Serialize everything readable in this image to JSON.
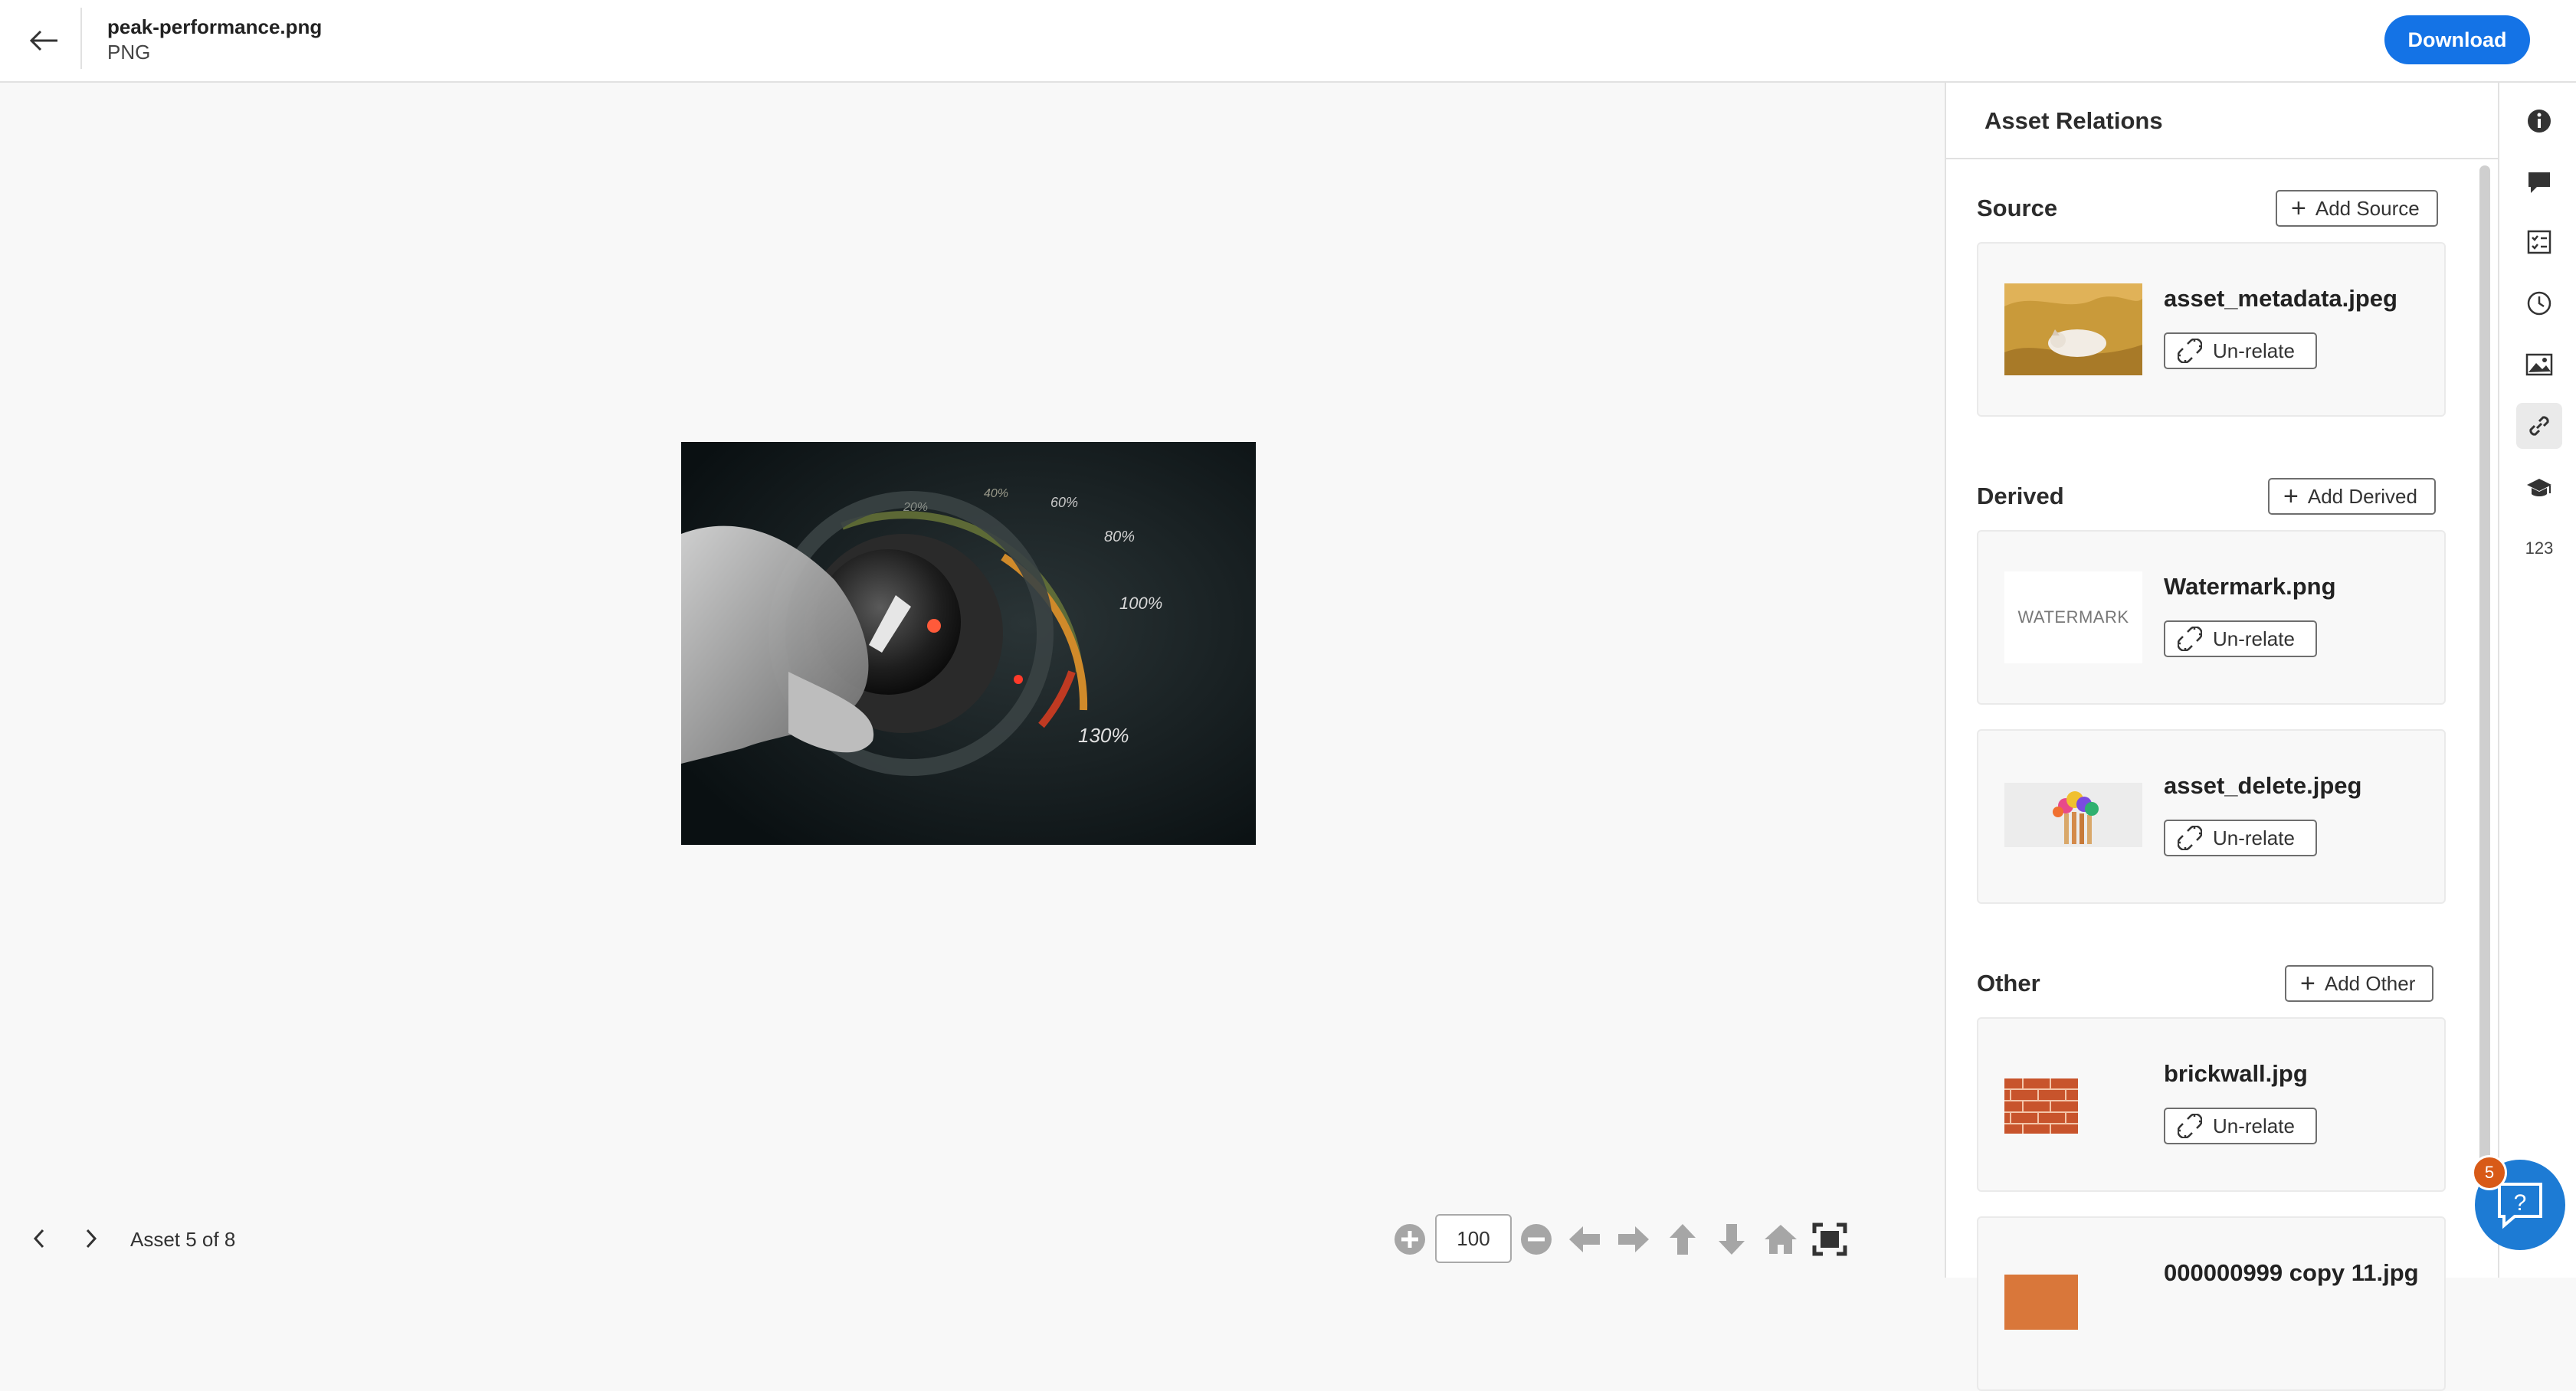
{
  "header": {
    "file_name": "peak-performance.png",
    "file_type": "PNG",
    "download_label": "Download"
  },
  "preview": {
    "gauge_labels": [
      "20%",
      "40%",
      "60%",
      "80%",
      "100%",
      "130%"
    ]
  },
  "footer": {
    "asset_count": "Asset 5 of 8",
    "zoom_value": "100"
  },
  "panel": {
    "title": "Asset Relations",
    "unrelate_label": "Un-relate",
    "sections": {
      "source": {
        "title": "Source",
        "add_label": "Add Source",
        "items": [
          {
            "name": "asset_metadata.jpeg"
          }
        ]
      },
      "derived": {
        "title": "Derived",
        "add_label": "Add Derived",
        "items": [
          {
            "name": "Watermark.png",
            "thumb_text": "WATERMARK"
          },
          {
            "name": "asset_delete.jpeg"
          }
        ]
      },
      "other": {
        "title": "Other",
        "add_label": "Add Other",
        "items": [
          {
            "name": "brickwall.jpg"
          },
          {
            "name": "000000999 copy 11.jpg"
          }
        ]
      }
    }
  },
  "rail": {
    "icons": [
      "info-icon",
      "comment-icon",
      "tasks-icon",
      "history-icon",
      "renditions-icon",
      "link-icon",
      "learn-icon",
      "metadata-numbers-icon"
    ],
    "numbers_label": "123",
    "active": "link-icon"
  },
  "help": {
    "badge_count": "5"
  },
  "colors": {
    "accent": "#1473e6",
    "badge": "#d85a17"
  }
}
